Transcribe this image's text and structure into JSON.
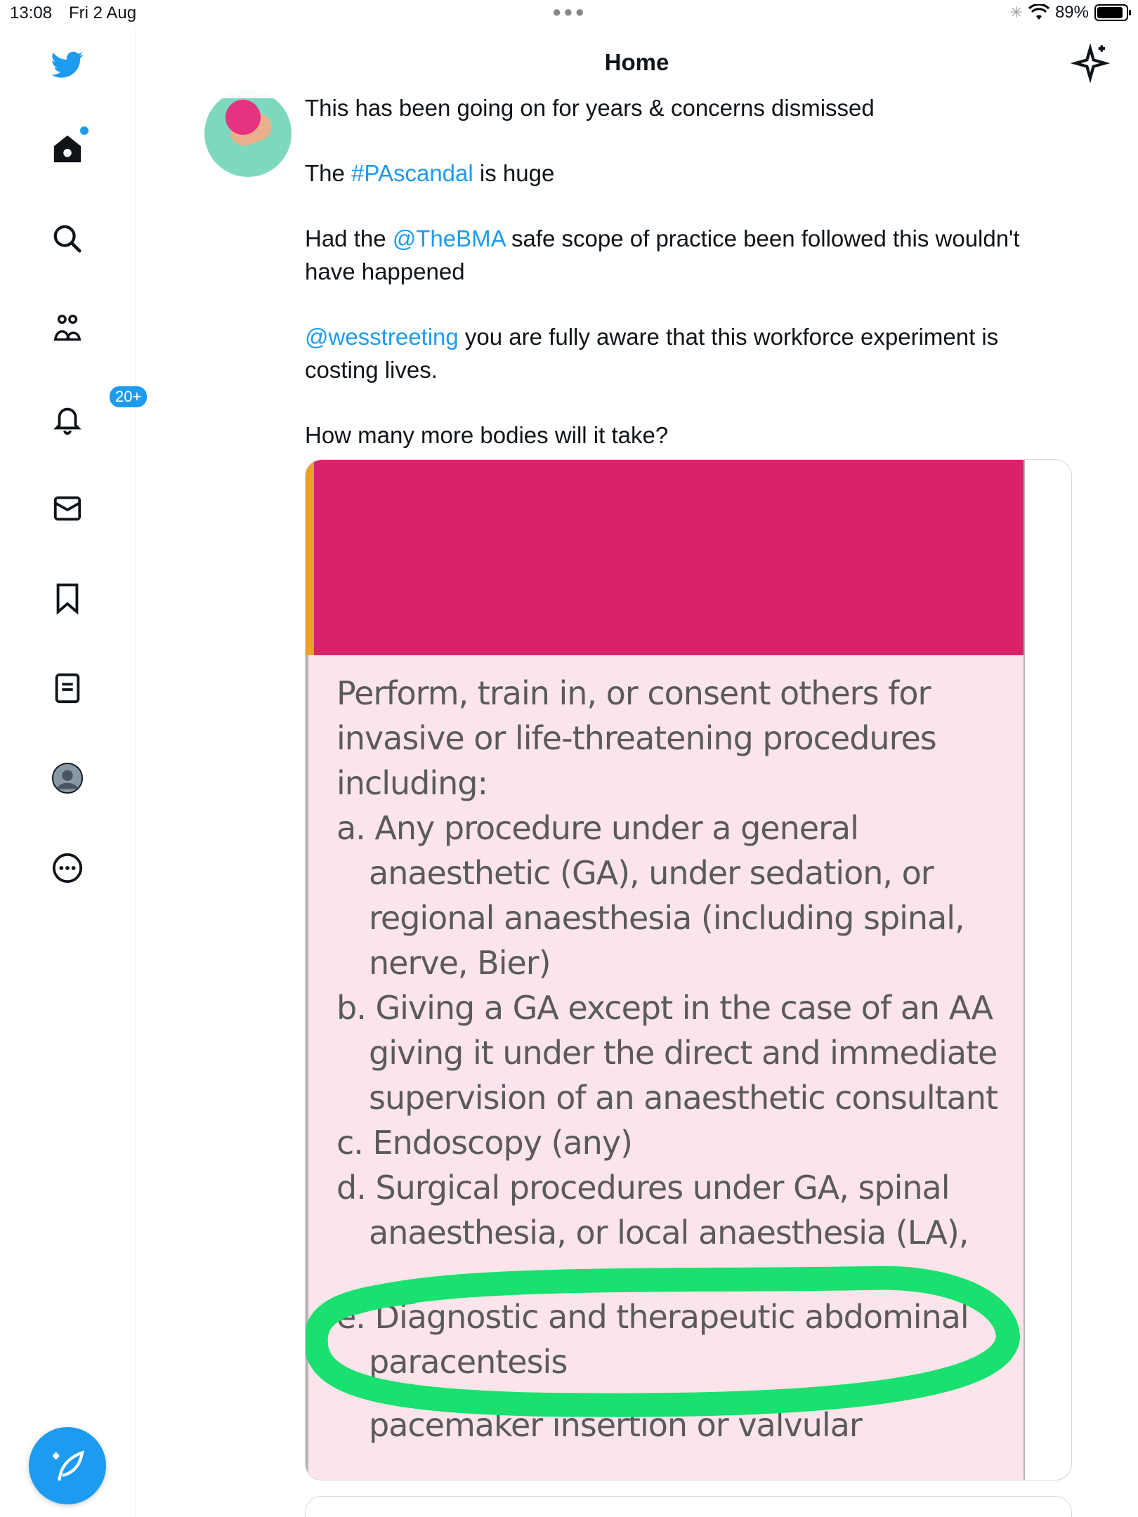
{
  "status_bar": {
    "time": "13:08",
    "date": "Fri 2 Aug",
    "battery": "89%"
  },
  "header": {
    "title": "Home"
  },
  "sidebar": {
    "notifications_badge": "20+"
  },
  "tweet": {
    "line1": "This has been going on for years & concerns dismissed",
    "p2_pre": "The ",
    "p2_link": "#PAscandal",
    "p2_post": " is huge",
    "p3_pre": "Had the ",
    "p3_link": "@TheBMA",
    "p3_post": " safe scope of practice been followed this wouldn't have happened",
    "p4_link": "@wesstreeting",
    "p4_post": " you are fully aware that this workforce experiment is costing lives.",
    "p5": "How many more bodies will it take?"
  },
  "media_doc": {
    "intro": "Perform, train in, or consent others for invasive or life-threatening procedures including:",
    "a": "a. Any procedure under a general anaesthetic (GA), under sedation, or regional anaesthesia (including spinal, nerve, Bier)",
    "b": "b. Giving a GA except in the case of an AA giving it under the direct and immediate supervision of an anaesthetic consultant",
    "c": "c. Endoscopy (any)",
    "d": "d. Surgical procedures under GA, spinal anaesthesia, or local anaesthesia (LA),",
    "e": "e. Diagnostic and therapeutic abdominal paracentesis",
    "f": "pacemaker insertion or valvular"
  },
  "colors": {
    "accent": "#1d9bf0",
    "banner": "#d82368",
    "highlight": "#19e06e"
  }
}
